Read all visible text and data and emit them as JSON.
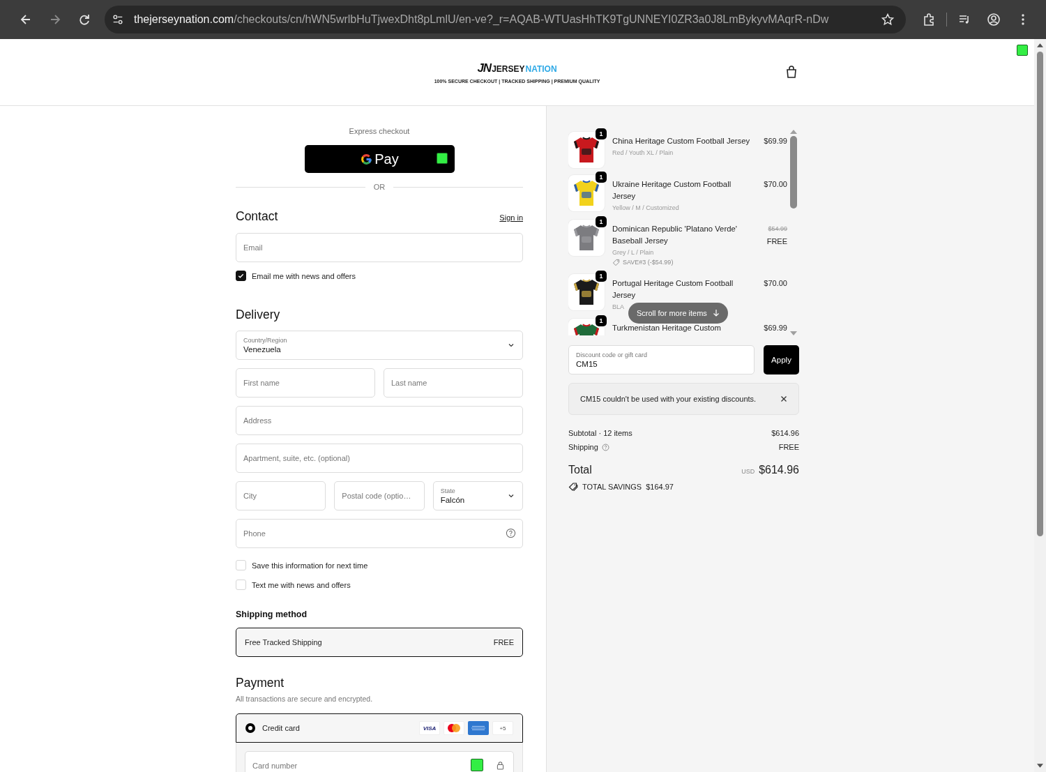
{
  "browser": {
    "domain": "thejerseynation.com",
    "path": "/checkouts/cn/hWN5wrlbHuTjwexDht8pLmlU/en-ve?_r=AQAB-WTUasHhTK9TgUNNEYI0ZR3a0J8LmBykyvMAqrR-nDw"
  },
  "header": {
    "logo_mark": "JN",
    "logo_word_1": "JERSEY",
    "logo_word_2": "NATION",
    "tagline": "100% SECURE CHECKOUT | TRACKED SHIPPING | PREMIUM QUALITY"
  },
  "express": {
    "title": "Express checkout",
    "button": "Pay",
    "divider": "OR"
  },
  "contact": {
    "title": "Contact",
    "sign_in": "Sign in",
    "email": {
      "placeholder": "Email"
    },
    "newsletter": {
      "label": "Email me with news and offers",
      "checked": true
    }
  },
  "delivery": {
    "title": "Delivery",
    "rows": [
      [
        {
          "kind": "select",
          "label": "Country/Region",
          "value": "Venezuela"
        }
      ],
      [
        {
          "kind": "input",
          "placeholder": "First name"
        },
        {
          "kind": "input",
          "placeholder": "Last name"
        }
      ],
      [
        {
          "kind": "input",
          "placeholder": "Address"
        }
      ],
      [
        {
          "kind": "input",
          "placeholder": "Apartment, suite, etc. (optional)"
        }
      ],
      [
        {
          "kind": "input",
          "placeholder": "City"
        },
        {
          "kind": "input",
          "placeholder": "Postal code (optio…"
        },
        {
          "kind": "select",
          "label": "State",
          "value": "Falcón"
        }
      ],
      [
        {
          "kind": "phone",
          "placeholder": "Phone"
        }
      ]
    ],
    "checkboxes": [
      {
        "label": "Save this information for next time",
        "checked": false
      },
      {
        "label": "Text me with news and offers",
        "checked": false
      }
    ]
  },
  "shipping_method": {
    "title": "Shipping method",
    "options": [
      {
        "name": "Free Tracked Shipping",
        "price": "FREE",
        "selected": true
      }
    ]
  },
  "payment": {
    "title": "Payment",
    "subtitle": "All transactions are secure and encrypted.",
    "methods": [
      {
        "name": "Credit card",
        "selected": true
      }
    ],
    "brands": [
      {
        "kind": "visa",
        "text": "VISA"
      },
      {
        "kind": "mastercard"
      },
      {
        "kind": "amex"
      },
      {
        "kind": "more",
        "text": "+5"
      }
    ],
    "card_number": {
      "placeholder": "Card number"
    }
  },
  "summary": {
    "items": [
      {
        "quantity": "1",
        "name": "China Heritage Custom Football Jersey",
        "variant": "Red / Youth XL / Plain",
        "price": "$69.99"
      },
      {
        "quantity": "1",
        "name": "Ukraine Heritage Custom Football Jersey",
        "variant": "Yellow / M / Customized",
        "price": "$70.00"
      },
      {
        "quantity": "1",
        "name": "Dominican Republic 'Platano Verde' Baseball Jersey",
        "variant": "Grey / L / Plain",
        "original_price": "$54.99",
        "price": "FREE",
        "discount": "SAVE#3 (-$54.99)"
      },
      {
        "quantity": "1",
        "name": "Portugal Heritage Custom Football Jersey",
        "variant": "BLA",
        "price": "$70.00"
      },
      {
        "quantity": "1",
        "name": "Turkmenistan Heritage Custom",
        "price": "$69.99"
      }
    ],
    "scroll_hint": "Scroll for more items",
    "discount": {
      "placeholder": "Discount code or gift card",
      "value": "CM15",
      "button": "Apply"
    },
    "error": "CM15 couldn't be used with your existing discounts.",
    "subtotal_label": "Subtotal · 12 items",
    "subtotal": "$614.96",
    "shipping_label": "Shipping",
    "shipping": "FREE",
    "total_label": "Total",
    "currency": "USD",
    "total": "$614.96",
    "savings_label": "TOTAL SAVINGS",
    "savings": "$164.97"
  }
}
